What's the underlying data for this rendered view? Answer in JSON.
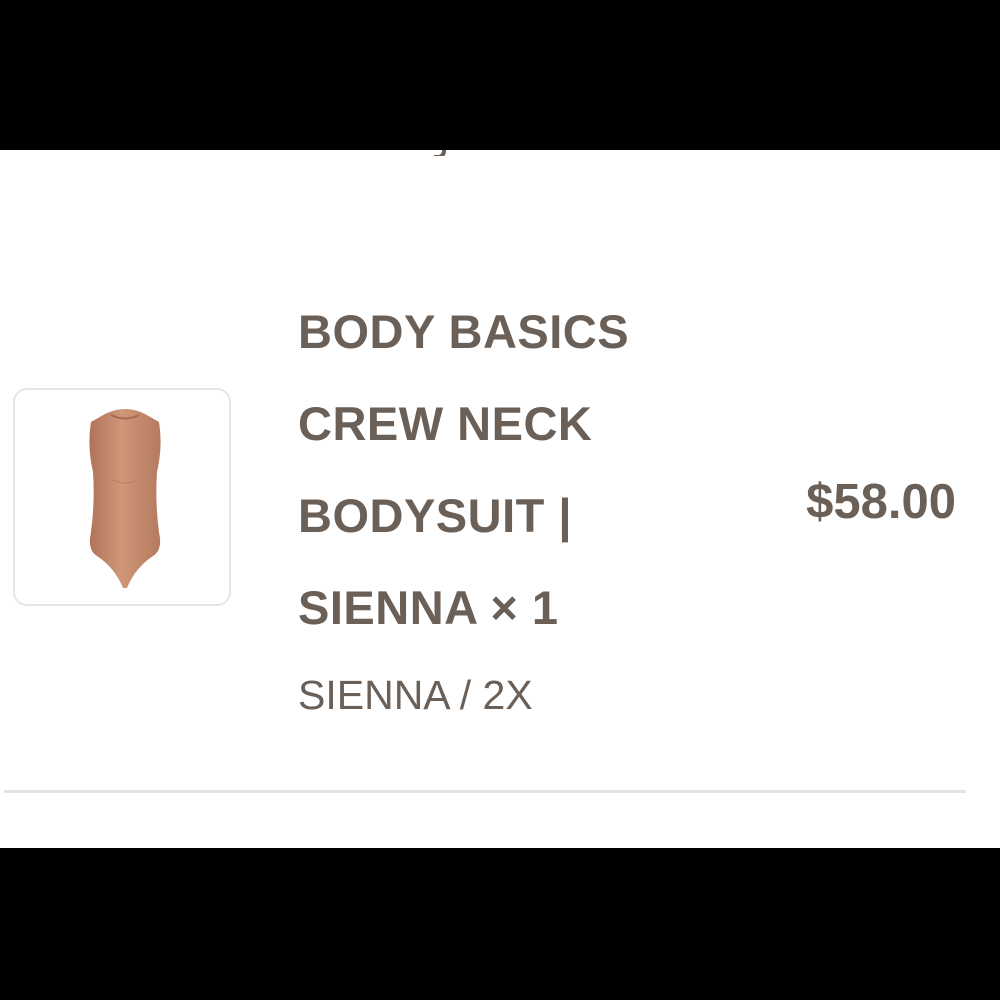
{
  "cart_item": {
    "title_lines": [
      "BODY BASICS",
      "CREW NECK",
      "BODYSUIT |",
      "SIENNA × 1"
    ],
    "variant": "SIENNA / 2X",
    "price": "$58.00",
    "thumbnail_color": "#c48a6e"
  },
  "colors": {
    "text": "#6b6057",
    "divider": "#e3e3e3",
    "thumb_border": "#e6e6e6"
  }
}
